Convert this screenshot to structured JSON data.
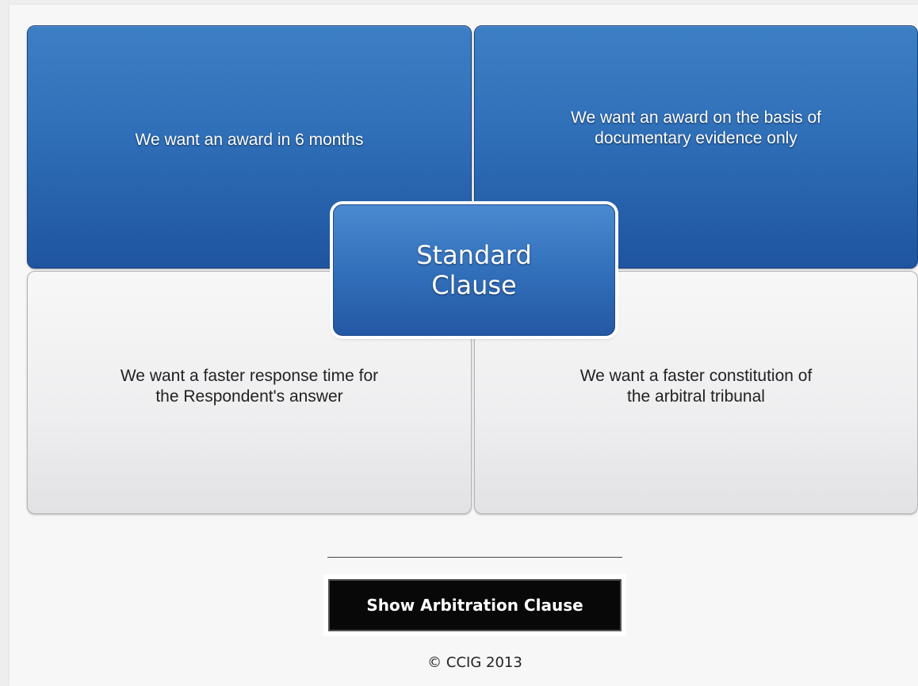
{
  "options": {
    "top_left": "We want an award in 6 months",
    "top_right": "We want an award on the basis of documentary evidence only",
    "bottom_left": "We want a faster response time for the Respondent's answer",
    "bottom_right": "We want a faster constitution of the arbitral tribunal"
  },
  "center": {
    "label": "Standard Clause"
  },
  "actions": {
    "show_clause_label": "Show Arbitration Clause"
  },
  "footer": {
    "copyright": "© CCIG 2013"
  },
  "colors": {
    "blue_tile": "#2f6fb8",
    "grey_tile": "#eeeef0",
    "button_bg": "#080808"
  }
}
